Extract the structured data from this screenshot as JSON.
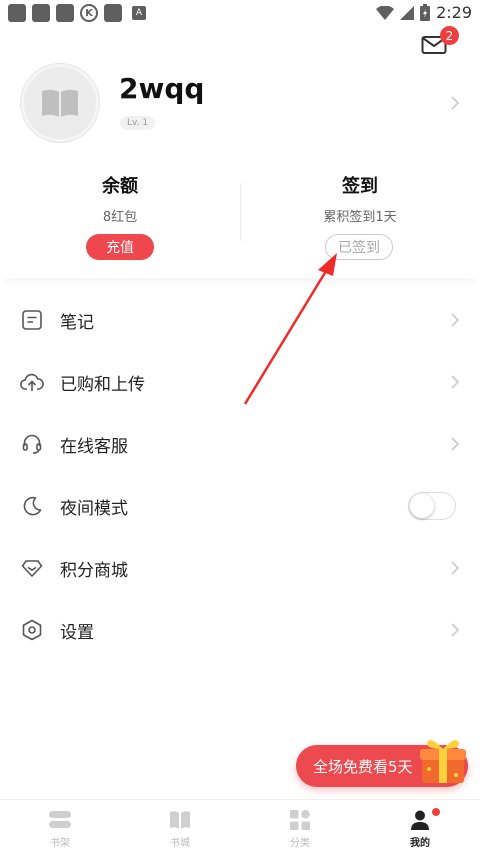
{
  "status_bar": {
    "time": "2:29",
    "k_icon": "K",
    "a_icon": "A"
  },
  "header": {
    "mail_badge": "2"
  },
  "profile": {
    "username": "2wqq",
    "level": "Lv. 1"
  },
  "balance": {
    "title": "余额",
    "value": "8红包",
    "button": "充值"
  },
  "checkin": {
    "title": "签到",
    "summary": "累积签到1天",
    "button": "已签到"
  },
  "menu": [
    {
      "label": "笔记",
      "icon": "note-icon"
    },
    {
      "label": "已购和上传",
      "icon": "cloud-upload-icon"
    },
    {
      "label": "在线客服",
      "icon": "headset-icon"
    },
    {
      "label": "夜间模式",
      "icon": "moon-icon",
      "toggle": false
    },
    {
      "label": "积分商城",
      "icon": "diamond-icon"
    },
    {
      "label": "设置",
      "icon": "settings-icon"
    }
  ],
  "promo": {
    "text": "全场免费看5天"
  },
  "bottom_nav": [
    {
      "label": "书架",
      "icon": "bookshelf-icon",
      "active": false
    },
    {
      "label": "书城",
      "icon": "book-icon",
      "active": false
    },
    {
      "label": "分类",
      "icon": "category-icon",
      "active": false
    },
    {
      "label": "我的",
      "icon": "person-icon",
      "active": true
    }
  ],
  "colors": {
    "accent": "#ef3f3f",
    "text": "#222222",
    "muted": "#999999"
  }
}
